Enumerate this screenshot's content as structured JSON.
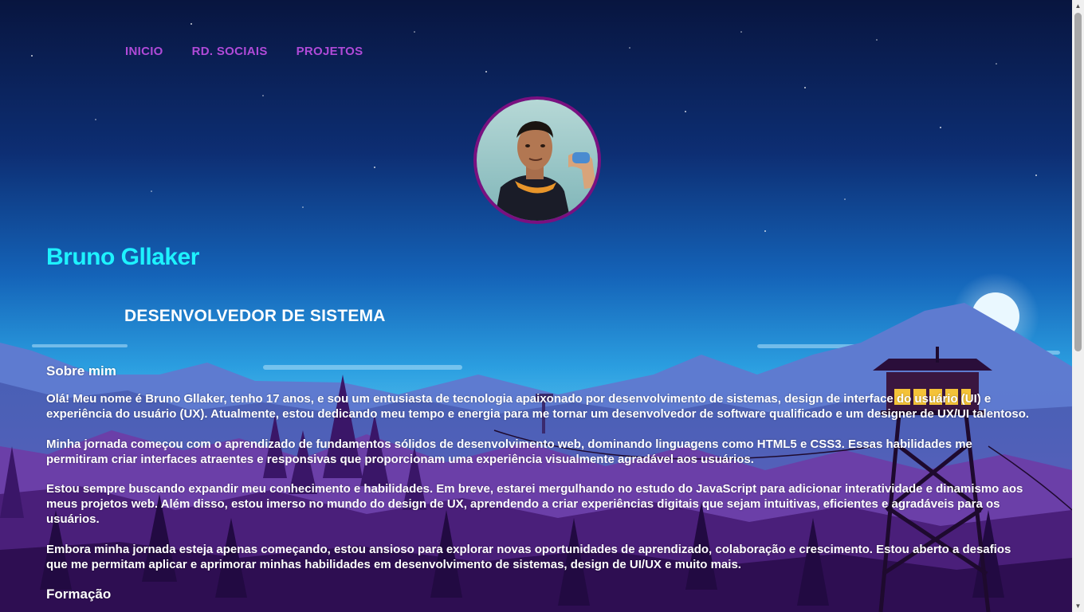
{
  "nav": {
    "items": [
      {
        "label": "INICIO"
      },
      {
        "label": "RD. SOCIAIS"
      },
      {
        "label": "PROJETOS"
      }
    ]
  },
  "profile": {
    "name": "Bruno Gllaker",
    "role": "DESENVOLVEDOR DE SISTEMA"
  },
  "about": {
    "heading": "Sobre mim",
    "paragraphs": [
      "Olá! Meu nome é Bruno Gllaker, tenho 17 anos, e sou um entusiasta de tecnologia apaixonado por desenvolvimento de sistemas, design de interface do usuário (UI) e experiência do usuário (UX). Atualmente, estou dedicando meu tempo e energia para me tornar um desenvolvedor de software qualificado e um designer de UX/UI talentoso.",
      "Minha jornada começou com o aprendizado de fundamentos sólidos de desenvolvimento web, dominando linguagens como HTML5 e CSS3. Essas habilidades me permitiram criar interfaces atraentes e responsivas que proporcionam uma experiência visualmente agradável aos usuários.",
      "Estou sempre buscando expandir meu conhecimento e habilidades. Em breve, estarei mergulhando no estudo do JavaScript para adicionar interatividade e dinamismo aos meus projetos web. Além disso, estou imerso no mundo do design de UX, aprendendo a criar experiências digitais que sejam intuitivas, eficientes e agradáveis para os usuários.",
      "Embora minha jornada esteja apenas começando, estou ansioso para explorar novas oportunidades de aprendizado, colaboração e crescimento. Estou aberto a desafios que me permitam aplicar e aprimorar minhas habilidades em desenvolvimento de sistemas, design de UI/UX e muito mais."
    ],
    "next_heading": "Formação"
  },
  "colors": {
    "nav": "#b04ad8",
    "name": "#1ef2ff",
    "avatar_border": "#7a1080"
  },
  "icons": {
    "scroll_up": "triangle-up-icon",
    "scroll_down": "triangle-down-icon"
  }
}
